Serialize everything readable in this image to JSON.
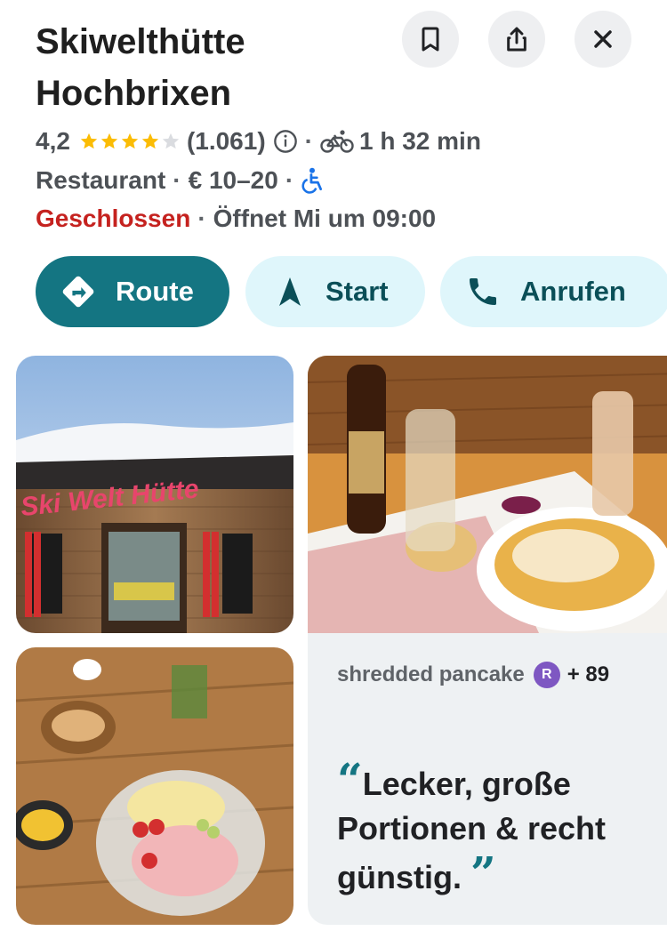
{
  "place": {
    "name_line1": "Skiwelthütte",
    "name_line2": "Hochbrixen"
  },
  "header_buttons": {
    "save_icon": "bookmark-icon",
    "share_icon": "share-icon",
    "close_icon": "close-icon"
  },
  "rating": {
    "value": "4,2",
    "stars": 4.2,
    "count": "(1.061)",
    "star_color": "#fbbc04",
    "bike_time": "1 h 32 min"
  },
  "details": {
    "category": "Restaurant",
    "price": "€ 10–20",
    "accessibility_icon": "wheelchair-icon",
    "status": "Geschlossen",
    "status_color": "#c5221f",
    "opens": "Öffnet Mi um 09:00"
  },
  "actions": {
    "route_label": "Route",
    "start_label": "Start",
    "call_label": "Anrufen"
  },
  "review": {
    "dish": "shredded pancake",
    "avatar_letter": "R",
    "others": "+ 89",
    "quote_open": "“",
    "text": "Lecker, große Portionen & recht günstig.",
    "quote_close": "”"
  },
  "images": {
    "sign_text": "Ski Welt Hütte"
  }
}
